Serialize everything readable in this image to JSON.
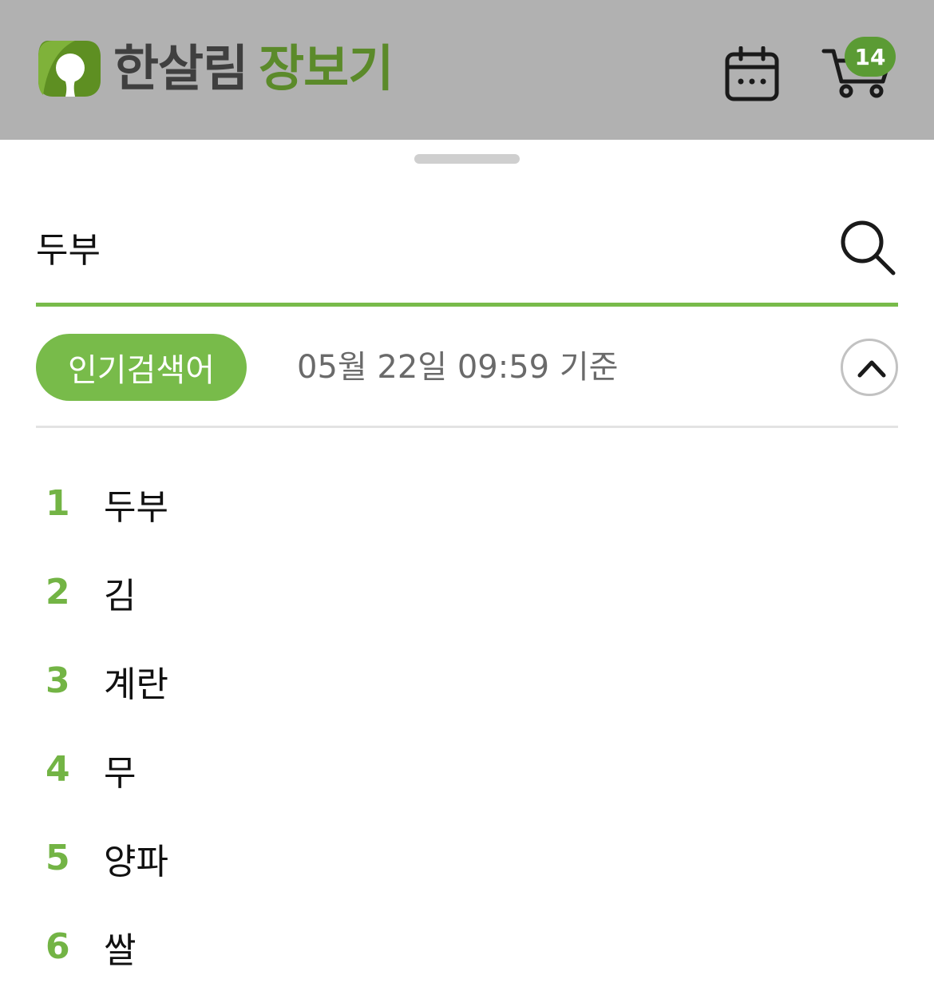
{
  "header": {
    "logo_primary": "한살림",
    "logo_secondary": "장보기",
    "cart_count": "14",
    "calendar_icon": "calendar-icon",
    "cart_icon": "cart-icon"
  },
  "search": {
    "value": "두부",
    "icon": "search-icon"
  },
  "popular": {
    "label": "인기검색어",
    "timestamp": "05월 22일 09:59 기준",
    "collapse_icon": "chevron-up-icon",
    "items": [
      {
        "rank": "1",
        "keyword": "두부"
      },
      {
        "rank": "2",
        "keyword": "김"
      },
      {
        "rank": "3",
        "keyword": "계란"
      },
      {
        "rank": "4",
        "keyword": "무"
      },
      {
        "rank": "5",
        "keyword": "양파"
      },
      {
        "rank": "6",
        "keyword": "쌀"
      }
    ]
  },
  "colors": {
    "header_bg": "#b1b1b1",
    "accent_green": "#78bb4a",
    "logo_green": "#5b8a2a",
    "badge_green": "#5b9b34"
  }
}
